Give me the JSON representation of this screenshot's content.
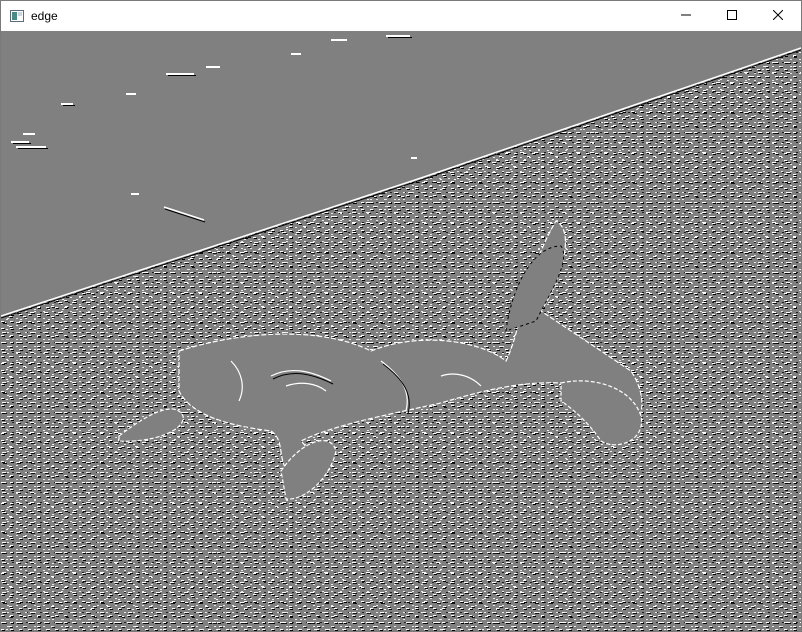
{
  "window": {
    "title": "edge",
    "icons": {
      "app": "image-window-icon",
      "minimize": "minimize-icon",
      "maximize": "maximize-icon",
      "close": "close-icon"
    }
  },
  "image": {
    "description_colors": {
      "background": "#808080",
      "edge_light": "#ffffff",
      "edge_dark": "#000000"
    }
  }
}
